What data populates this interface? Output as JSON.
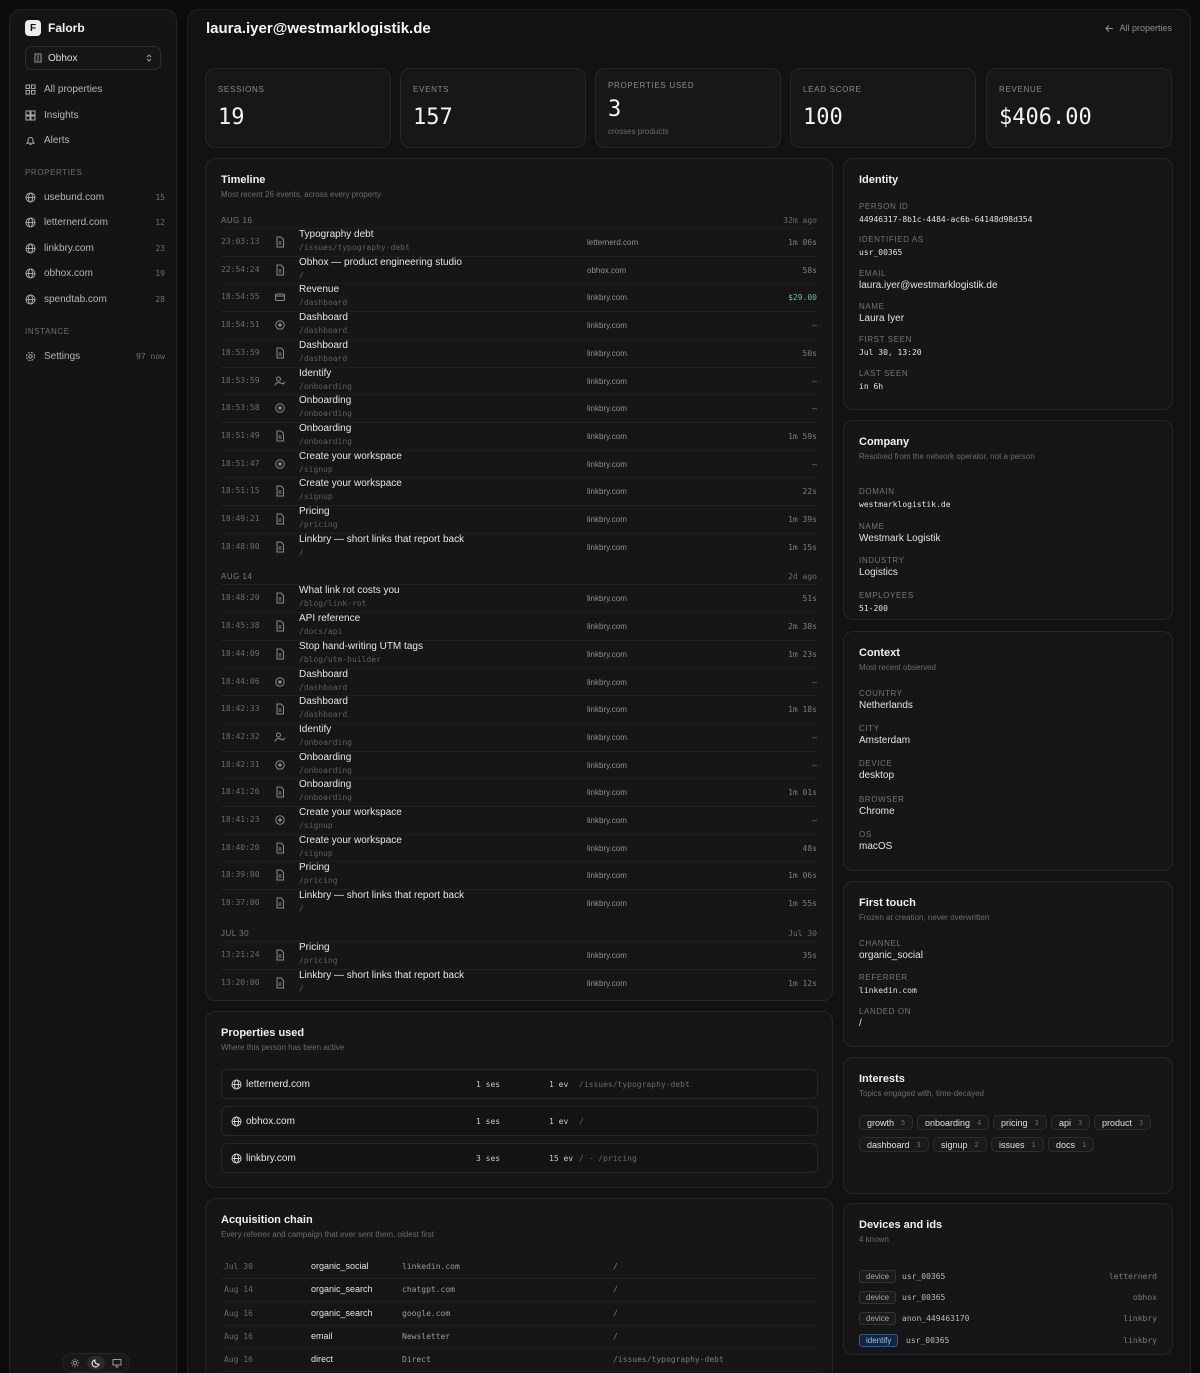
{
  "app": {
    "name": "Falorb",
    "logo_letter": "F",
    "workspace": "Obhox"
  },
  "nav": [
    {
      "label": "All properties",
      "icon": "grid-icon"
    },
    {
      "label": "Insights",
      "icon": "insights-icon"
    },
    {
      "label": "Alerts",
      "icon": "bell-icon"
    }
  ],
  "properties_section": {
    "label": "PROPERTIES",
    "items": [
      {
        "label": "usebund.com",
        "count": "15"
      },
      {
        "label": "letternerd.com",
        "count": "12"
      },
      {
        "label": "linkbry.com",
        "count": "23"
      },
      {
        "label": "obhox.com",
        "count": "19"
      },
      {
        "label": "spendtab.com",
        "count": "28"
      }
    ]
  },
  "instance_section": {
    "label": "INSTANCE",
    "items": [
      {
        "label": "Settings",
        "count": "97 now"
      }
    ]
  },
  "header": {
    "title": "laura.iyer@westmarklogistik.de",
    "back_label": "All properties"
  },
  "stats": [
    {
      "label": "SESSIONS",
      "value": "19"
    },
    {
      "label": "EVENTS",
      "value": "157"
    },
    {
      "label": "PROPERTIES USED",
      "value": "3",
      "sub": "crosses products"
    },
    {
      "label": "LEAD SCORE",
      "value": "100"
    },
    {
      "label": "REVENUE",
      "value": "$406.00"
    }
  ],
  "timeline": {
    "title": "Timeline",
    "subtitle": "Most recent 26 events, across every property",
    "groups": [
      {
        "date": "AUG 16",
        "ago": "32m ago",
        "events": [
          {
            "time": "23:03:13",
            "icon": "page-icon",
            "title": "Typography debt",
            "path": "/issues/typography-debt",
            "domain": "letternerd.com",
            "duration": "1m 06s"
          },
          {
            "time": "22:54:24",
            "icon": "page-icon",
            "title": "Obhox — product engineering studio",
            "path": "/",
            "domain": "obhox.com",
            "duration": "58s"
          },
          {
            "time": "18:54:55",
            "icon": "card-icon",
            "title": "Revenue",
            "path": "/dashboard",
            "domain": "linkbry.com",
            "duration": "$29.00"
          },
          {
            "time": "18:54:51",
            "icon": "target-icon",
            "title": "Dashboard",
            "path": "/dashboard",
            "domain": "linkbry.com",
            "duration": "—"
          },
          {
            "time": "18:53:59",
            "icon": "page-icon",
            "title": "Dashboard",
            "path": "/dashboard",
            "domain": "linkbry.com",
            "duration": "50s"
          },
          {
            "time": "18:53:59",
            "icon": "user-check-icon",
            "title": "Identify",
            "path": "/onboarding",
            "domain": "linkbry.com",
            "duration": "—"
          },
          {
            "time": "18:53:58",
            "icon": "target-icon",
            "title": "Onboarding",
            "path": "/onboarding",
            "domain": "linkbry.com",
            "duration": "—"
          },
          {
            "time": "18:51:49",
            "icon": "page-icon",
            "title": "Onboarding",
            "path": "/onboarding",
            "domain": "linkbry.com",
            "duration": "1m 59s"
          },
          {
            "time": "18:51:47",
            "icon": "target-icon",
            "title": "Create your workspace",
            "path": "/signup",
            "domain": "linkbry.com",
            "duration": "—"
          },
          {
            "time": "18:51:15",
            "icon": "page-icon",
            "title": "Create your workspace",
            "path": "/signup",
            "domain": "linkbry.com",
            "duration": "22s"
          },
          {
            "time": "18:49:21",
            "icon": "page-icon",
            "title": "Pricing",
            "path": "/pricing",
            "domain": "linkbry.com",
            "duration": "1m 39s"
          },
          {
            "time": "18:48:00",
            "icon": "page-icon",
            "title": "Linkbry — short links that report back",
            "path": "/",
            "domain": "linkbry.com",
            "duration": "1m 15s"
          }
        ]
      },
      {
        "date": "AUG 14",
        "ago": "2d ago",
        "events": [
          {
            "time": "18:48:20",
            "icon": "page-icon",
            "title": "What link rot costs you",
            "path": "/blog/link-rot",
            "domain": "linkbry.com",
            "duration": "51s"
          },
          {
            "time": "18:45:38",
            "icon": "page-icon",
            "title": "API reference",
            "path": "/docs/api",
            "domain": "linkbry.com",
            "duration": "2m 38s"
          },
          {
            "time": "18:44:09",
            "icon": "page-icon",
            "title": "Stop hand-writing UTM tags",
            "path": "/blog/utm-builder",
            "domain": "linkbry.com",
            "duration": "1m 23s"
          },
          {
            "time": "18:44:06",
            "icon": "target-icon",
            "title": "Dashboard",
            "path": "/dashboard",
            "domain": "linkbry.com",
            "duration": "—"
          },
          {
            "time": "18:42:33",
            "icon": "page-icon",
            "title": "Dashboard",
            "path": "/dashboard",
            "domain": "linkbry.com",
            "duration": "1m 18s"
          },
          {
            "time": "18:42:32",
            "icon": "user-check-icon",
            "title": "Identify",
            "path": "/onboarding",
            "domain": "linkbry.com",
            "duration": "—"
          },
          {
            "time": "18:42:31",
            "icon": "target-icon",
            "title": "Onboarding",
            "path": "/onboarding",
            "domain": "linkbry.com",
            "duration": "—"
          },
          {
            "time": "18:41:26",
            "icon": "page-icon",
            "title": "Onboarding",
            "path": "/onboarding",
            "domain": "linkbry.com",
            "duration": "1m 01s"
          },
          {
            "time": "18:41:23",
            "icon": "target-icon",
            "title": "Create your workspace",
            "path": "/signup",
            "domain": "linkbry.com",
            "duration": "—"
          },
          {
            "time": "18:40:20",
            "icon": "page-icon",
            "title": "Create your workspace",
            "path": "/signup",
            "domain": "linkbry.com",
            "duration": "48s"
          },
          {
            "time": "18:39:00",
            "icon": "page-icon",
            "title": "Pricing",
            "path": "/pricing",
            "domain": "linkbry.com",
            "duration": "1m 06s"
          },
          {
            "time": "18:37:00",
            "icon": "page-icon",
            "title": "Linkbry — short links that report back",
            "path": "/",
            "domain": "linkbry.com",
            "duration": "1m 55s"
          }
        ]
      },
      {
        "date": "JUL 30",
        "ago": "Jul 30",
        "events": [
          {
            "time": "13:21:24",
            "icon": "page-icon",
            "title": "Pricing",
            "path": "/pricing",
            "domain": "linkbry.com",
            "duration": "35s"
          },
          {
            "time": "13:20:00",
            "icon": "page-icon",
            "title": "Linkbry — short links that report back",
            "path": "/",
            "domain": "linkbry.com",
            "duration": "1m 12s"
          }
        ]
      }
    ]
  },
  "properties_used": {
    "title": "Properties used",
    "subtitle": "Where this person has been active",
    "rows": [
      {
        "name": "letternerd.com",
        "sessions": "1 ses",
        "events": "1 ev",
        "paths": "/issues/typography-debt"
      },
      {
        "name": "obhox.com",
        "sessions": "1 ses",
        "events": "1 ev",
        "paths": "/"
      },
      {
        "name": "linkbry.com",
        "sessions": "3 ses",
        "events": "15 ev",
        "paths": "/ · /pricing"
      }
    ]
  },
  "acquisition": {
    "title": "Acquisition chain",
    "subtitle": "Every referrer and campaign that ever sent them, oldest first",
    "rows": [
      {
        "date": "Jul 30",
        "channel": "organic_social",
        "referrer": "linkedin.com",
        "landing": "/"
      },
      {
        "date": "Aug 14",
        "channel": "organic_search",
        "referrer": "chatgpt.com",
        "landing": "/"
      },
      {
        "date": "Aug 16",
        "channel": "organic_search",
        "referrer": "google.com",
        "landing": "/"
      },
      {
        "date": "Aug 16",
        "channel": "email",
        "referrer": "Newsletter",
        "landing": "/"
      },
      {
        "date": "Aug 16",
        "channel": "direct",
        "referrer": "Direct",
        "landing": "/issues/typography-debt"
      }
    ]
  },
  "identity": {
    "title": "Identity",
    "fields": [
      {
        "label": "PERSON ID",
        "value": "44946317-8b1c-4484-ac6b-64148d98d354",
        "mono": true
      },
      {
        "label": "IDENTIFIED AS",
        "value": "usr_00365",
        "mono": true
      },
      {
        "label": "EMAIL",
        "value": "laura.iyer@westmarklogistik.de",
        "mono": false
      },
      {
        "label": "NAME",
        "value": "Laura Iyer",
        "mono": false
      },
      {
        "label": "FIRST SEEN",
        "value": "Jul 30, 13:20",
        "mono": true
      },
      {
        "label": "LAST SEEN",
        "value": "in 6h",
        "mono": true
      }
    ]
  },
  "company": {
    "title": "Company",
    "subtitle": "Resolved from the network operator, not a person",
    "fields": [
      {
        "label": "DOMAIN",
        "value": "westmarklogistik.de",
        "mono": true
      },
      {
        "label": "NAME",
        "value": "Westmark Logistik",
        "mono": false
      },
      {
        "label": "INDUSTRY",
        "value": "Logistics",
        "mono": false
      },
      {
        "label": "EMPLOYEES",
        "value": "51-200",
        "mono": true
      }
    ]
  },
  "context": {
    "title": "Context",
    "subtitle": "Most recent observed",
    "fields": [
      {
        "label": "COUNTRY",
        "value": "Netherlands",
        "mono": false
      },
      {
        "label": "CITY",
        "value": "Amsterdam",
        "mono": false
      },
      {
        "label": "DEVICE",
        "value": "desktop",
        "mono": false
      },
      {
        "label": "BROWSER",
        "value": "Chrome",
        "mono": false
      },
      {
        "label": "OS",
        "value": "macOS",
        "mono": false
      }
    ]
  },
  "first_touch": {
    "title": "First touch",
    "subtitle": "Frozen at creation, never overwritten",
    "fields": [
      {
        "label": "CHANNEL",
        "value": "organic_social",
        "mono": false
      },
      {
        "label": "REFERRER",
        "value": "linkedin.com",
        "mono": true
      },
      {
        "label": "LANDED ON",
        "value": "/",
        "mono": false
      }
    ]
  },
  "interests": {
    "title": "Interests",
    "subtitle": "Topics engaged with, time-decayed",
    "chips": [
      {
        "label": "growth",
        "count": "5"
      },
      {
        "label": "onboarding",
        "count": "4"
      },
      {
        "label": "pricing",
        "count": "3"
      },
      {
        "label": "api",
        "count": "3"
      },
      {
        "label": "product",
        "count": "3"
      },
      {
        "label": "dashboard",
        "count": "3"
      },
      {
        "label": "signup",
        "count": "2"
      },
      {
        "label": "issues",
        "count": "1"
      },
      {
        "label": "docs",
        "count": "1"
      }
    ]
  },
  "devices": {
    "title": "Devices and ids",
    "subtitle": "4 known",
    "rows": [
      {
        "type": "device",
        "id": "usr_00365",
        "source": "letternerd"
      },
      {
        "type": "device",
        "id": "usr_00365",
        "source": "obhox"
      },
      {
        "type": "device",
        "id": "anon_449463170",
        "source": "linkbry"
      },
      {
        "type": "identify",
        "id": "usr_00365",
        "source": "linkbry"
      }
    ]
  },
  "colors": {
    "money": "#56c98f",
    "identify_badge": "#8fc3ff"
  }
}
